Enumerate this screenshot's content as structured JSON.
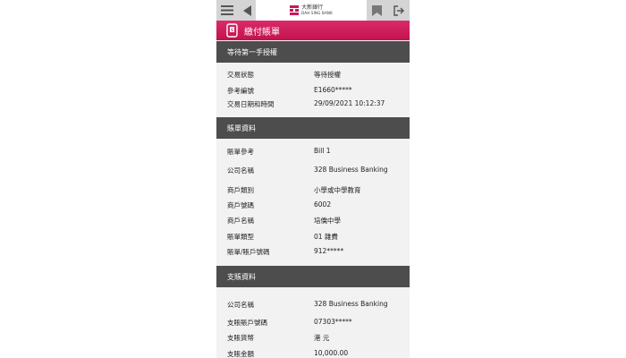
{
  "header": {
    "logo_zh": "大新銀行",
    "logo_en": "DAH SING BANK",
    "title": "繳付賬單",
    "icons": [
      "menu-icon",
      "back-arrow-icon",
      "bookmark-icon",
      "logout-icon",
      "bill-payment-icon"
    ],
    "brand_color": "#c8175c"
  },
  "section1": {
    "title": "等待第一手授權",
    "rows": [
      {
        "label": "交易狀態",
        "value": "等待授權"
      },
      {
        "label": "參考編號",
        "value": "E1660*****"
      },
      {
        "label": "交易日期和時間",
        "value": "29/09/2021 10:12:37"
      }
    ]
  },
  "section2": {
    "title": "賬單資料",
    "rows": [
      {
        "label": "賬單參考",
        "value": "Bill 1"
      },
      {
        "label": "公司名稱",
        "value": "328 Business Banking"
      },
      {
        "label": "商戶類別",
        "value": "小學或中學教育"
      },
      {
        "label": "商戶號碼",
        "value": "6002"
      },
      {
        "label": "商戶名稱",
        "value": "培僑中學"
      },
      {
        "label": "賬單類型",
        "value": "01 雜費"
      },
      {
        "label": "賬單/賬戶號碼",
        "value": "912*****"
      }
    ]
  },
  "section3": {
    "title": "支賬資料",
    "rows": [
      {
        "label": "公司名稱",
        "value": "328 Business Banking"
      },
      {
        "label": "支賬賬戶號碼",
        "value": "07303*****"
      },
      {
        "label": "支賬貨幣",
        "value": "港 元"
      },
      {
        "label": "支賬金額",
        "value": "10,000.00"
      }
    ]
  }
}
